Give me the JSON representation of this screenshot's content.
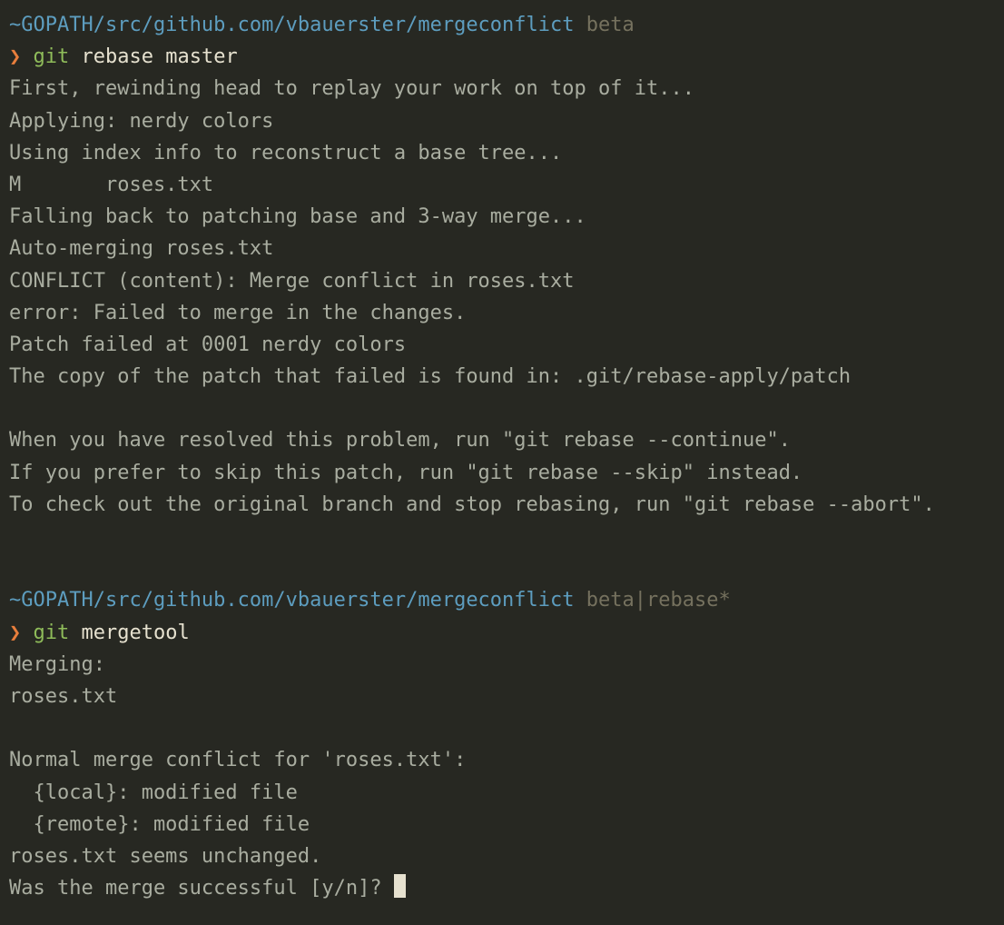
{
  "prompt1": {
    "path": "~GOPATH/src/github.com/vbauerster/mergeconflict",
    "branch": "beta",
    "chevron": "❯",
    "cmd_git": "git",
    "cmd_args": "rebase master"
  },
  "output1": {
    "l1": "First, rewinding head to replay your work on top of it...",
    "l2": "Applying: nerdy colors",
    "l3": "Using index info to reconstruct a base tree...",
    "l4": "M       roses.txt",
    "l5": "Falling back to patching base and 3-way merge...",
    "l6": "Auto-merging roses.txt",
    "l7": "CONFLICT (content): Merge conflict in roses.txt",
    "l8": "error: Failed to merge in the changes.",
    "l9": "Patch failed at 0001 nerdy colors",
    "l10": "The copy of the patch that failed is found in: .git/rebase-apply/patch",
    "l11": "When you have resolved this problem, run \"git rebase --continue\".",
    "l12": "If you prefer to skip this patch, run \"git rebase --skip\" instead.",
    "l13": "To check out the original branch and stop rebasing, run \"git rebase --abort\"."
  },
  "prompt2": {
    "path": "~GOPATH/src/github.com/vbauerster/mergeconflict",
    "branch": "beta|rebase*",
    "chevron": "❯",
    "cmd_git": "git",
    "cmd_args": "mergetool"
  },
  "output2": {
    "l1": "Merging:",
    "l2": "roses.txt",
    "l3": "Normal merge conflict for 'roses.txt':",
    "l4": "  {local}: modified file",
    "l5": "  {remote}: modified file",
    "l6": "roses.txt seems unchanged.",
    "l7": "Was the merge successful [y/n]? "
  }
}
